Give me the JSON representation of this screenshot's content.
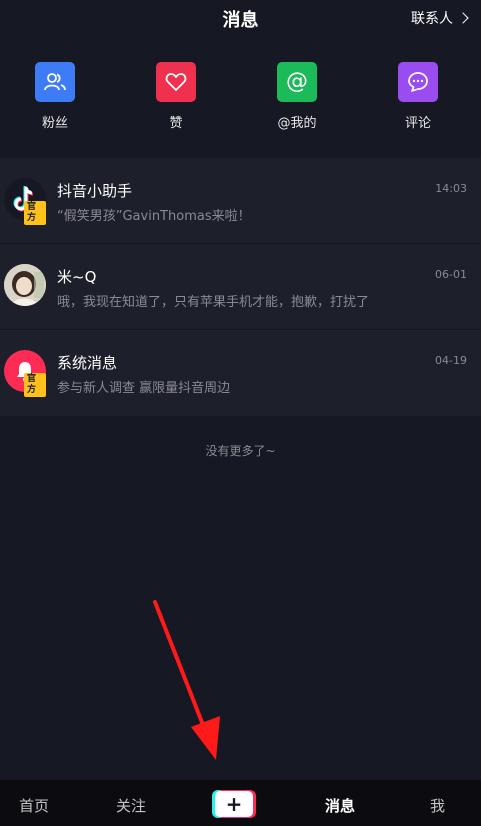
{
  "header": {
    "title": "消息",
    "contacts_label": "联系人"
  },
  "categories": [
    {
      "label": "粉丝",
      "icon": "fans-icon",
      "color": "#3d7cf4"
    },
    {
      "label": "赞",
      "icon": "heart-icon",
      "color": "#f0304f"
    },
    {
      "label": "@我的",
      "icon": "at-icon",
      "color": "#1dba5a"
    },
    {
      "label": "评论",
      "icon": "comment-icon",
      "color": "#9a4cf0"
    }
  ],
  "messages": [
    {
      "name": "抖音小助手",
      "message": "“假笑男孩”GavinThomas来啦！",
      "time": "14:03",
      "badge": "官方",
      "avatar": "tiktok-logo-avatar"
    },
    {
      "name": "米~Q",
      "message": "哦，我现在知道了，只有苹果手机才能，抱歉，打扰了",
      "time": "06-01",
      "avatar": "user-photo-avatar"
    },
    {
      "name": "系统消息",
      "message": "参与新人调查 赢限量抖音周边",
      "time": "04-19",
      "badge": "官方",
      "avatar": "bell-avatar"
    }
  ],
  "no_more": "没有更多了~",
  "tabbar": {
    "home": "首页",
    "follow": "关注",
    "create": "+",
    "messages": "消息",
    "me": "我"
  },
  "colors": {
    "background": "#161823",
    "list_bg": "#1d1f2a",
    "annotation_arrow": "#ff1a1a"
  }
}
